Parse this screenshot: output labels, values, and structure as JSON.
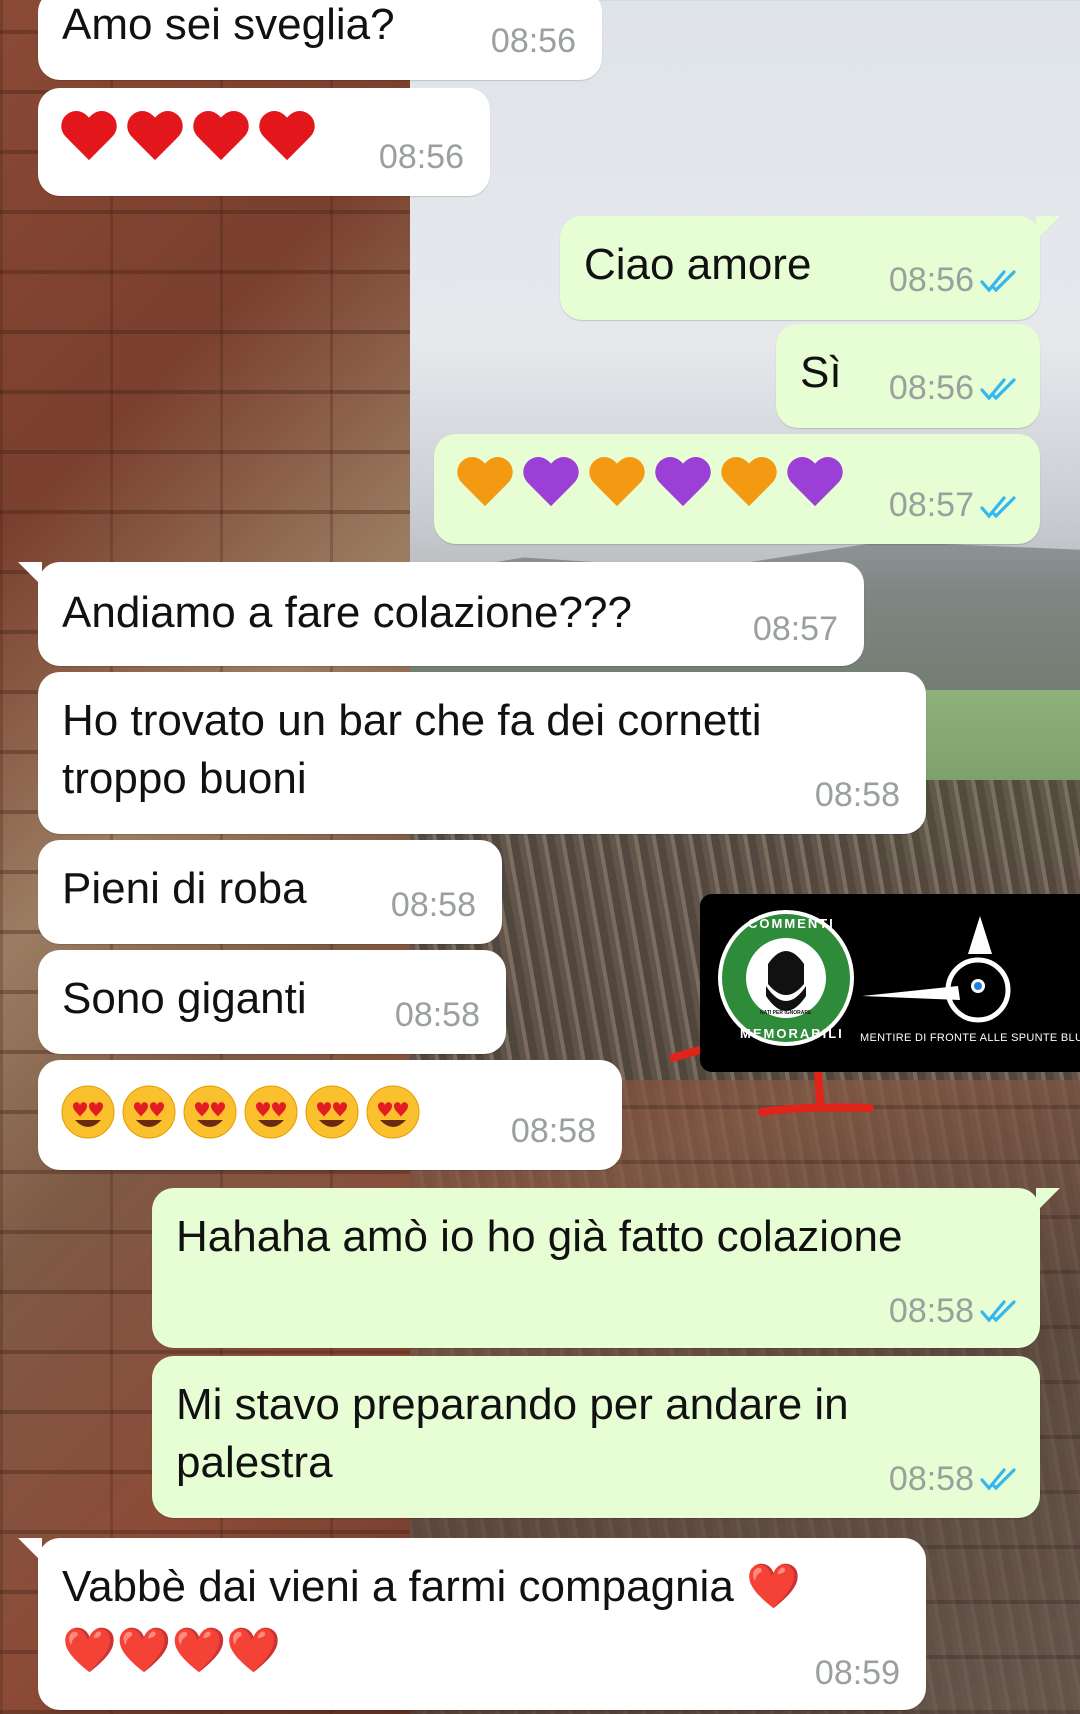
{
  "messages": [
    {
      "id": "m1",
      "side": "in",
      "text": "Amo sei sveglia?",
      "time": "08:56"
    },
    {
      "id": "m2",
      "side": "in",
      "emoji": "❤️❤️❤️❤️",
      "time": "08:56"
    },
    {
      "id": "m3",
      "side": "out",
      "text": "Ciao amore",
      "time": "08:56",
      "status": "read"
    },
    {
      "id": "m4",
      "side": "out",
      "text": "Sì",
      "time": "08:56",
      "status": "read"
    },
    {
      "id": "m5",
      "side": "out",
      "emoji": "🧡💜🧡💜🧡💜",
      "time": "08:57",
      "status": "read"
    },
    {
      "id": "m6",
      "side": "in",
      "text": "Andiamo a fare colazione???",
      "time": "08:57"
    },
    {
      "id": "m7",
      "side": "in",
      "text_lines": [
        "Ho trovato un bar che fa dei cornetti",
        "troppo buoni"
      ],
      "time": "08:58"
    },
    {
      "id": "m8",
      "side": "in",
      "text": "Pieni di roba",
      "time": "08:58"
    },
    {
      "id": "m9",
      "side": "in",
      "text": "Sono giganti",
      "time": "08:58"
    },
    {
      "id": "m10",
      "side": "in",
      "emoji": "😍😍😍😍😍😍",
      "time": "08:58"
    },
    {
      "id": "m11",
      "side": "out",
      "text": "Hahaha amò io ho già fatto colazione",
      "time": "08:58",
      "status": "read"
    },
    {
      "id": "m12",
      "side": "out",
      "text_lines": [
        "Mi stavo preparando per andare in",
        "palestra"
      ],
      "time": "08:58",
      "status": "read"
    },
    {
      "id": "m13",
      "side": "in",
      "text_lines": [
        "Vabbè dai vieni a farmi compagnia ❤️",
        "❤️❤️❤️❤️"
      ],
      "time": "08:59"
    }
  ],
  "watermark": {
    "badge_top": "COMMENTI",
    "badge_bottom": "MEMORABILI",
    "badge_small": "NATI PER IGNORARE",
    "caption": "MENTIRE DI FRONTE ALLE SPUNTE BLU"
  },
  "colors": {
    "incoming_bubble": "#ffffff",
    "outgoing_bubble": "#e7fdd4",
    "read_ticks": "#34b7f1",
    "timestamp": "#9aa09c",
    "badge_green": "#2e8b3a",
    "scribble_red": "#e0241a"
  }
}
